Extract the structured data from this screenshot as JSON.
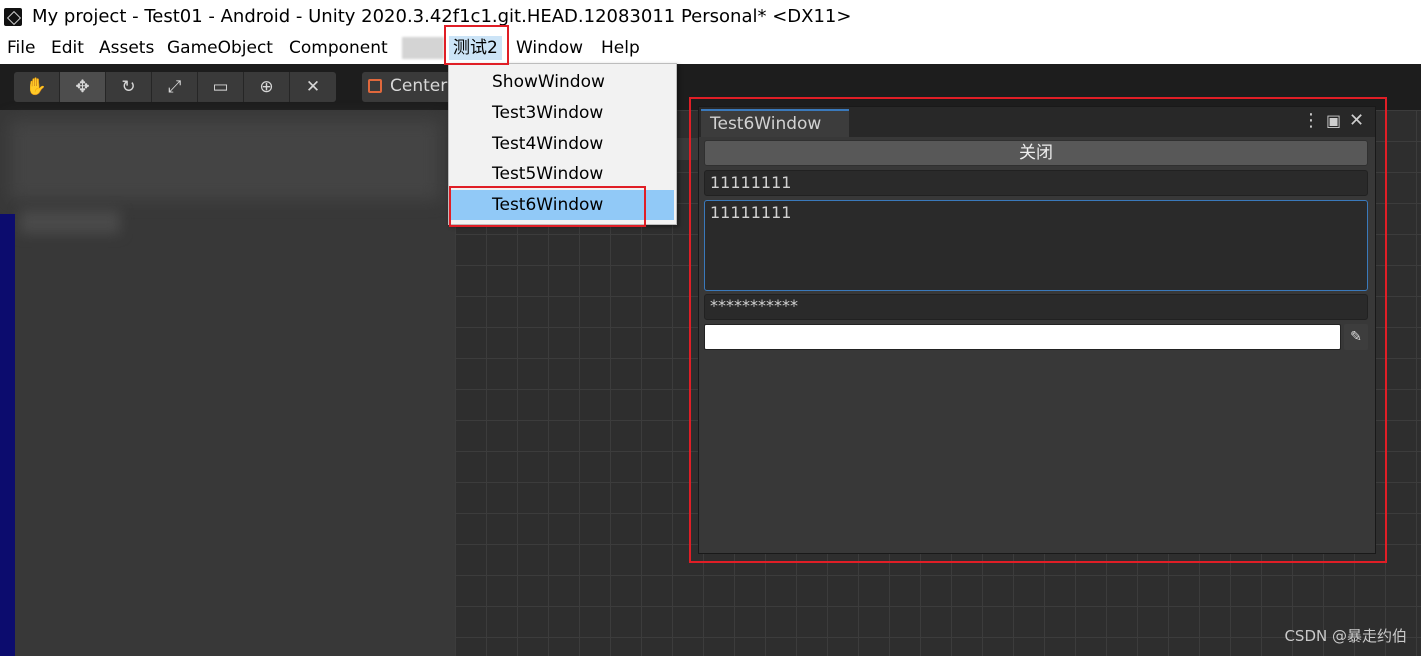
{
  "titlebar": {
    "title": "My project - Test01 - Android - Unity 2020.3.42f1c1.git.HEAD.12083011 Personal* <DX11>"
  },
  "menubar": {
    "items": [
      "File",
      "Edit",
      "Assets",
      "GameObject",
      "Component",
      "测试2",
      "Window",
      "Help"
    ],
    "active": "测试2"
  },
  "toolbar": {
    "tools": [
      "hand-tool",
      "move-tool",
      "rotate-tool",
      "scale-tool",
      "rect-tool",
      "transform-tool",
      "custom-tool"
    ],
    "pivot_label": "Center"
  },
  "dropdown": {
    "items": [
      "ShowWindow",
      "Test3Window",
      "Test4Window",
      "Test5Window",
      "Test6Window"
    ],
    "highlighted": "Test6Window"
  },
  "window": {
    "tab_title": "Test6Window",
    "close_button": "关闭",
    "text_field": "11111111",
    "text_area": "11111111",
    "password_field": "***********",
    "color_value": "#ffffff"
  },
  "watermark": "CSDN @暴走约伯",
  "colors": {
    "highlight_red": "#e01e26",
    "menu_highlight": "#91c9f7",
    "tab_accent": "#3a79bb"
  }
}
